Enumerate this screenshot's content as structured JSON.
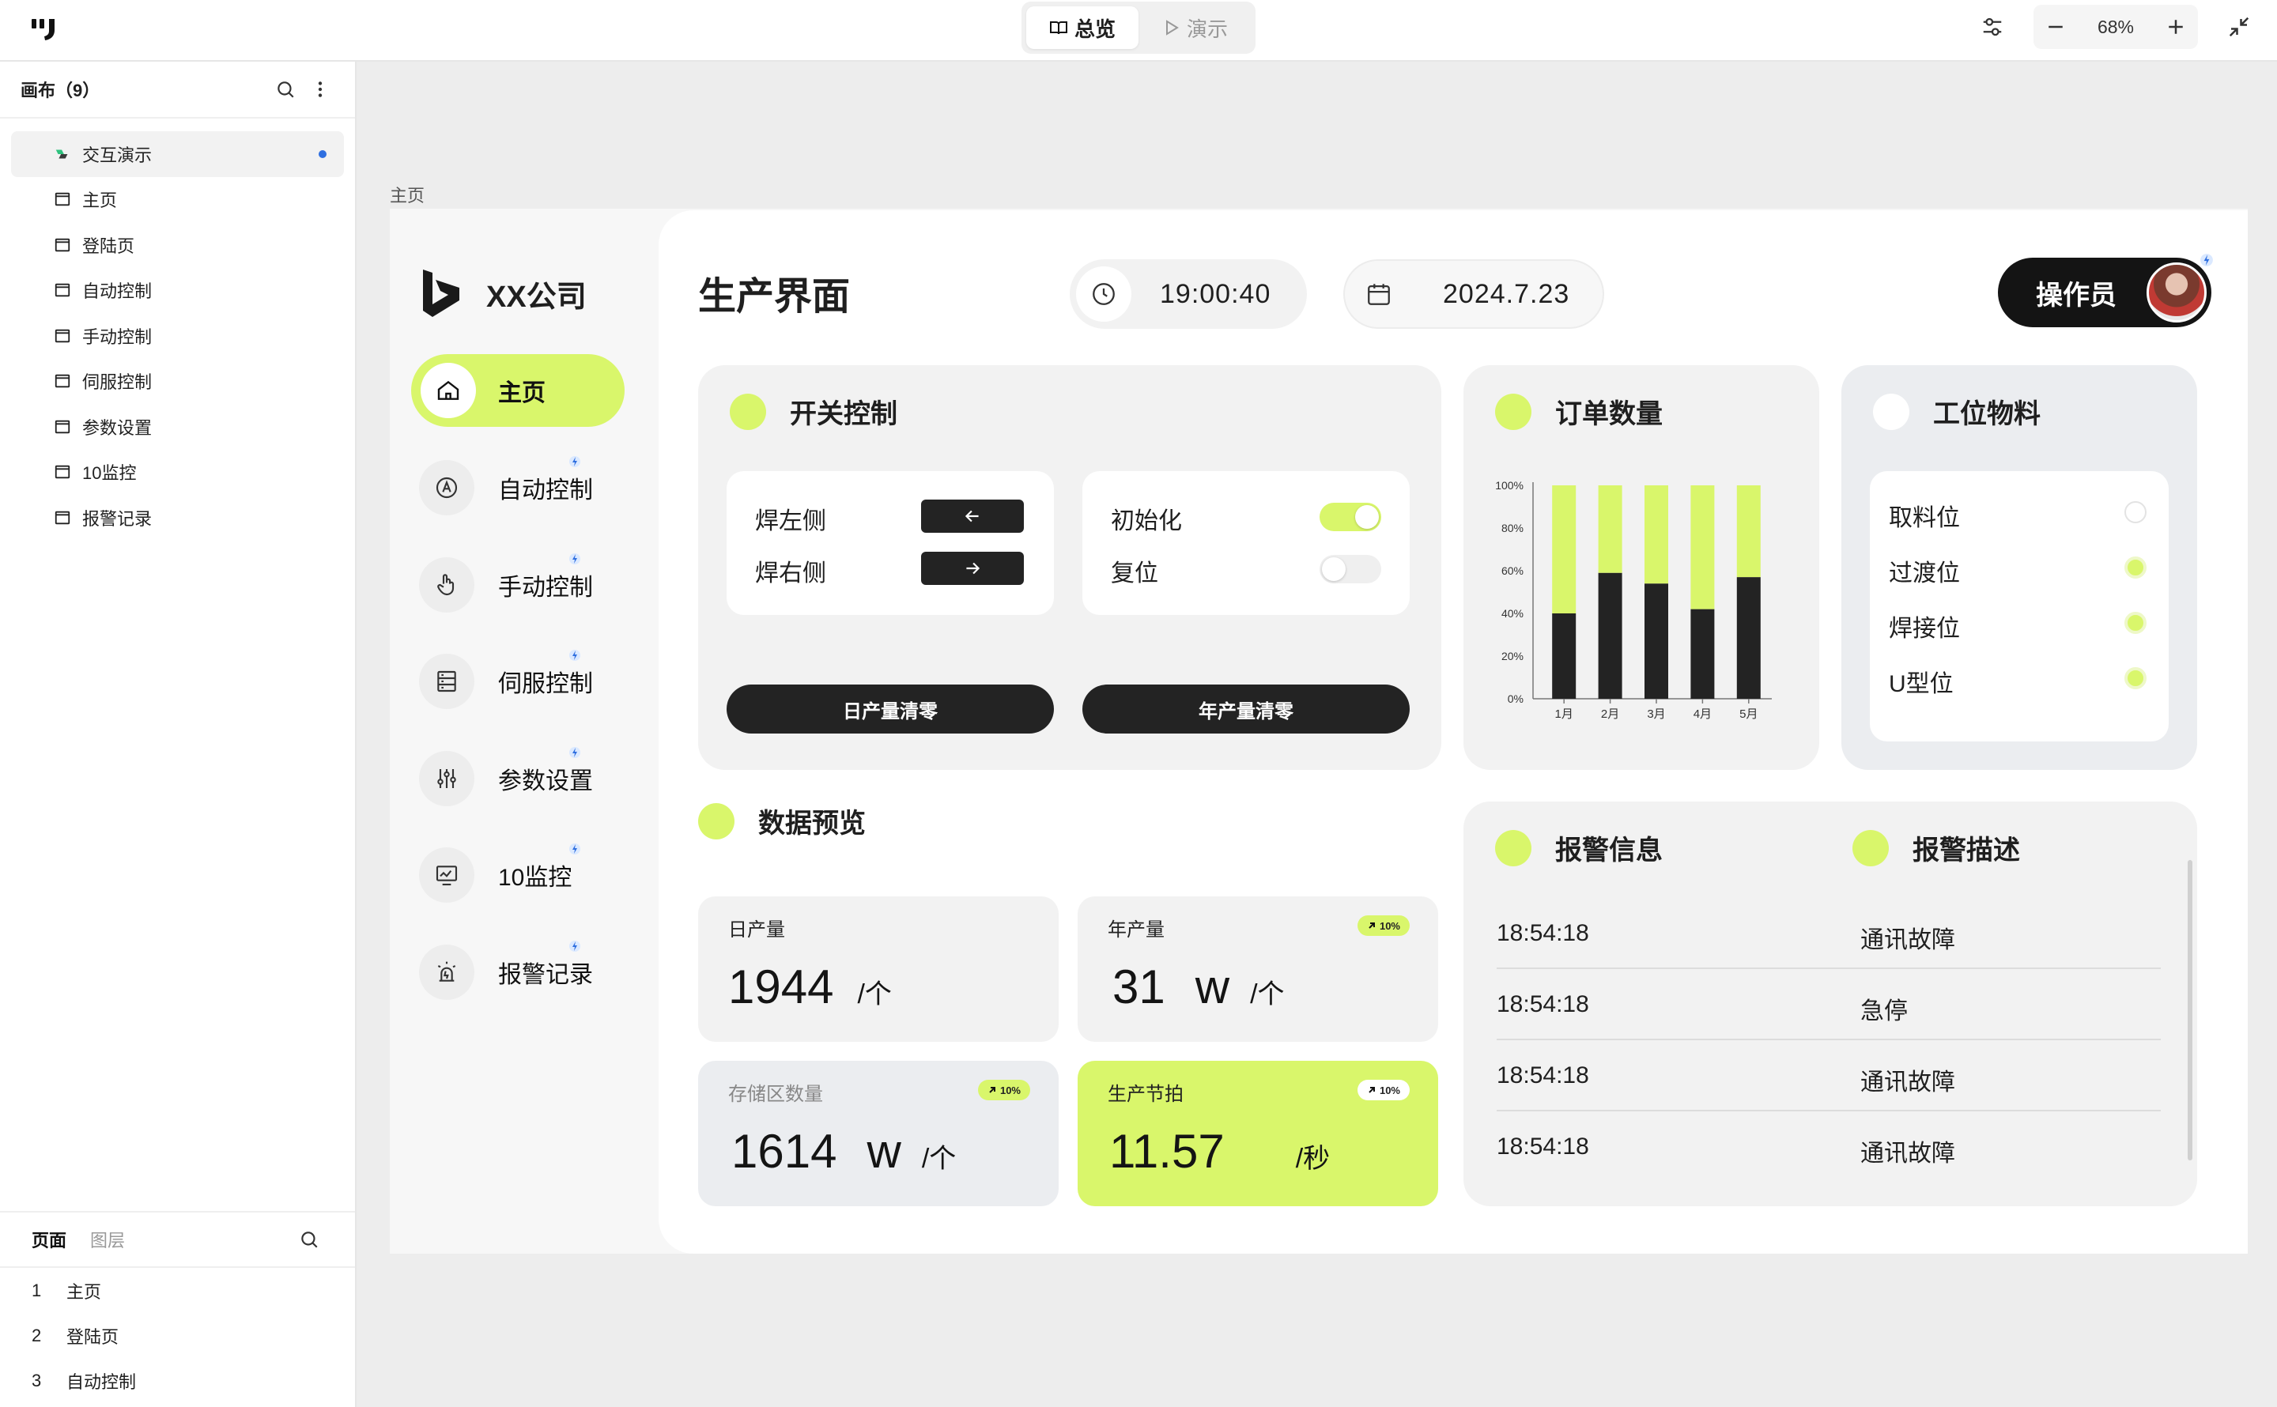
{
  "topbar": {
    "mode_overview": "总览",
    "mode_demo": "演示",
    "zoom": "68%"
  },
  "left_panel": {
    "canvas_title": "画布（9）",
    "tree": [
      {
        "label": "交互演示",
        "type": "flow",
        "selected": true
      },
      {
        "label": "主页",
        "type": "page"
      },
      {
        "label": "登陆页",
        "type": "page"
      },
      {
        "label": "自动控制",
        "type": "page"
      },
      {
        "label": "手动控制",
        "type": "page"
      },
      {
        "label": "伺服控制",
        "type": "page"
      },
      {
        "label": "参数设置",
        "type": "page"
      },
      {
        "label": "10监控",
        "type": "page"
      },
      {
        "label": "报警记录",
        "type": "page"
      }
    ],
    "tab_pages": "页面",
    "tab_layers": "图层",
    "pages": [
      {
        "num": "1",
        "label": "主页"
      },
      {
        "num": "2",
        "label": "登陆页"
      },
      {
        "num": "3",
        "label": "自动控制"
      }
    ]
  },
  "frame_label": "主页",
  "app": {
    "brand": "XX公司",
    "nav": [
      {
        "label": "主页",
        "icon": "home-icon",
        "active": true
      },
      {
        "label": "自动控制",
        "icon": "auto-icon"
      },
      {
        "label": "手动控制",
        "icon": "hand-icon"
      },
      {
        "label": "伺服控制",
        "icon": "servo-icon"
      },
      {
        "label": "参数设置",
        "icon": "sliders-icon"
      },
      {
        "label": "10监控",
        "icon": "monitor-icon"
      },
      {
        "label": "报警记录",
        "icon": "alarm-icon"
      }
    ],
    "title": "生产界面",
    "time": "19:00:40",
    "date": "2024.7.23",
    "operator": "操作员"
  },
  "switch_card": {
    "title": "开关控制",
    "weld_left": "焊左侧",
    "weld_right": "焊右侧",
    "init": "初始化",
    "init_on": true,
    "reset": "复位",
    "reset_on": false,
    "day_reset": "日产量清零",
    "year_reset": "年产量清零"
  },
  "order_card": {
    "title": "订单数量"
  },
  "material_card": {
    "title": "工位物料",
    "items": [
      {
        "label": "取料位",
        "on": false
      },
      {
        "label": "过渡位",
        "on": true
      },
      {
        "label": "焊接位",
        "on": true
      },
      {
        "label": "U型位",
        "on": true
      }
    ]
  },
  "data_preview": {
    "title": "数据预览",
    "daily": {
      "label": "日产量",
      "value": "1944",
      "unit": "/个"
    },
    "yearly": {
      "label": "年产量",
      "value": "31",
      "w": "w",
      "unit": "/个",
      "badge": "10%"
    },
    "storage": {
      "label": "存储区数量",
      "value": "1614",
      "w": "w",
      "unit": "/个",
      "badge": "10%"
    },
    "beat": {
      "label": "生产节拍",
      "value": "11.57",
      "unit": "/秒",
      "badge": "10%"
    }
  },
  "alarm_card": {
    "title_info": "报警信息",
    "title_desc": "报警描述",
    "rows": [
      {
        "time": "18:54:18",
        "desc": "通讯故障"
      },
      {
        "time": "18:54:18",
        "desc": "急停"
      },
      {
        "time": "18:54:18",
        "desc": "通讯故障"
      },
      {
        "time": "18:54:18",
        "desc": "通讯故障"
      }
    ]
  },
  "colors": {
    "accent": "#d9f66b",
    "dark": "#232323",
    "card": "#f2f2f2"
  },
  "chart_data": {
    "type": "bar",
    "stacked": true,
    "categories": [
      "1月",
      "2月",
      "3月",
      "4月",
      "5月"
    ],
    "series": [
      {
        "values": [
          40,
          59,
          54,
          42,
          57
        ],
        "color": "#232323"
      },
      {
        "values": [
          60,
          41,
          46,
          58,
          43
        ],
        "color": "#d9f66b"
      }
    ],
    "yticks": [
      "0%",
      "20%",
      "40%",
      "60%",
      "80%",
      "100%"
    ],
    "ylim": [
      0,
      100
    ]
  }
}
